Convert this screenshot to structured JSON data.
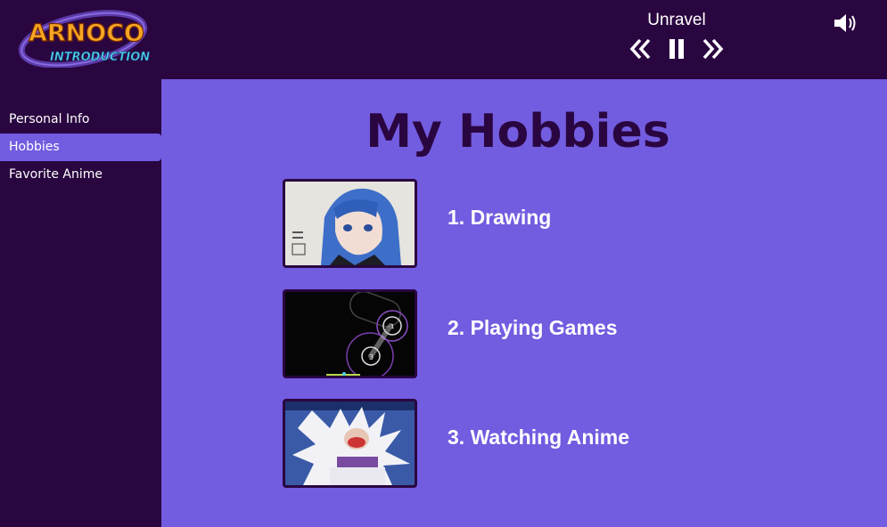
{
  "header": {
    "logo": {
      "title": "ARNOCO",
      "subtitle": "INTRODUCTION"
    },
    "player": {
      "song_title": "Unravel",
      "controls": [
        "rewind-icon",
        "pause-icon",
        "fast-forward-icon"
      ],
      "volume_icon": "volume-icon"
    }
  },
  "sidebar": {
    "items": [
      {
        "label": "Personal Info",
        "active": false
      },
      {
        "label": "Hobbies",
        "active": true
      },
      {
        "label": "Favorite Anime",
        "active": false
      }
    ]
  },
  "main": {
    "title": "My Hobbies",
    "hobbies": [
      {
        "label": "1. Drawing",
        "image": "drawing-thumbnail"
      },
      {
        "label": "2. Playing Games",
        "image": "game-thumbnail"
      },
      {
        "label": "3. Watching Anime",
        "image": "anime-thumbnail"
      }
    ]
  },
  "colors": {
    "background_dark": "#2a0640",
    "accent_purple": "#725ce0",
    "text_white": "#ffffff",
    "title_dark": "#2a0640"
  }
}
